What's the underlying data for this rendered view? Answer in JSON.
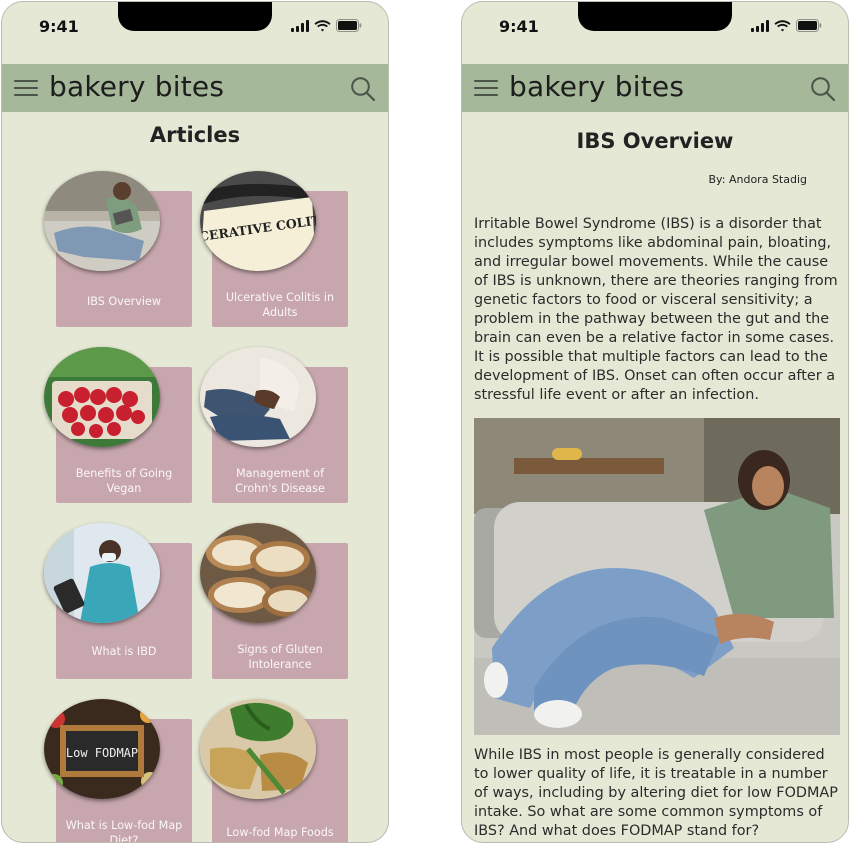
{
  "status": {
    "time": "9:41"
  },
  "app": {
    "brand": "bakery bites"
  },
  "articles_screen": {
    "title": "Articles",
    "cards": [
      {
        "label": "IBS Overview",
        "image": "woman-on-couch"
      },
      {
        "label": "Ulcerative Colitis in Adults",
        "image": "ulcerative-colitis-note",
        "image_text": "ULCERATIVE COLITIS"
      },
      {
        "label": "Benefits of Going Vegan",
        "image": "strawberries"
      },
      {
        "label": "Management of Crohn's Disease",
        "image": "person-holding-stomach"
      },
      {
        "label": "What is IBD",
        "image": "doctor-with-tablet"
      },
      {
        "label": "Signs of Gluten Intolerance",
        "image": "sliced-bread"
      },
      {
        "label": "What is Low-fod Map Diet?",
        "image": "low-fodmap-chalkboard",
        "image_text": "Low FODMAP"
      },
      {
        "label": "Low-fod Map Foods",
        "image": "vegetable-dish"
      }
    ]
  },
  "article_screen": {
    "title": "IBS Overview",
    "author": "By: Andora Stadig",
    "paragraph1": "Irritable Bowel Syndrome (IBS) is a disorder that includes symptoms like abdominal pain, bloating, and irregular bowel movements.  While the cause of IBS is unknown, there are theories ranging from genetic factors to food or visceral sensitivity; a problem in the pathway between the gut and the brain can even be a relative factor in some cases. It is possible that multiple factors can lead to the development of IBS. Onset can often occur after a stressful life event or after an infection.",
    "image": "woman-lying-on-couch-holding-stomach",
    "paragraph2": " While IBS in most people is generally considered to lower quality of life, it is treatable in a number of ways, including by altering diet for low FODMAP intake. So what are some common symptoms of IBS? And what does FODMAP stand for?"
  },
  "colors": {
    "background": "#e6e8d6",
    "app_bar": "#a6b89a",
    "card": "#c7a7ad",
    "card_text": "#fbf7f7"
  }
}
